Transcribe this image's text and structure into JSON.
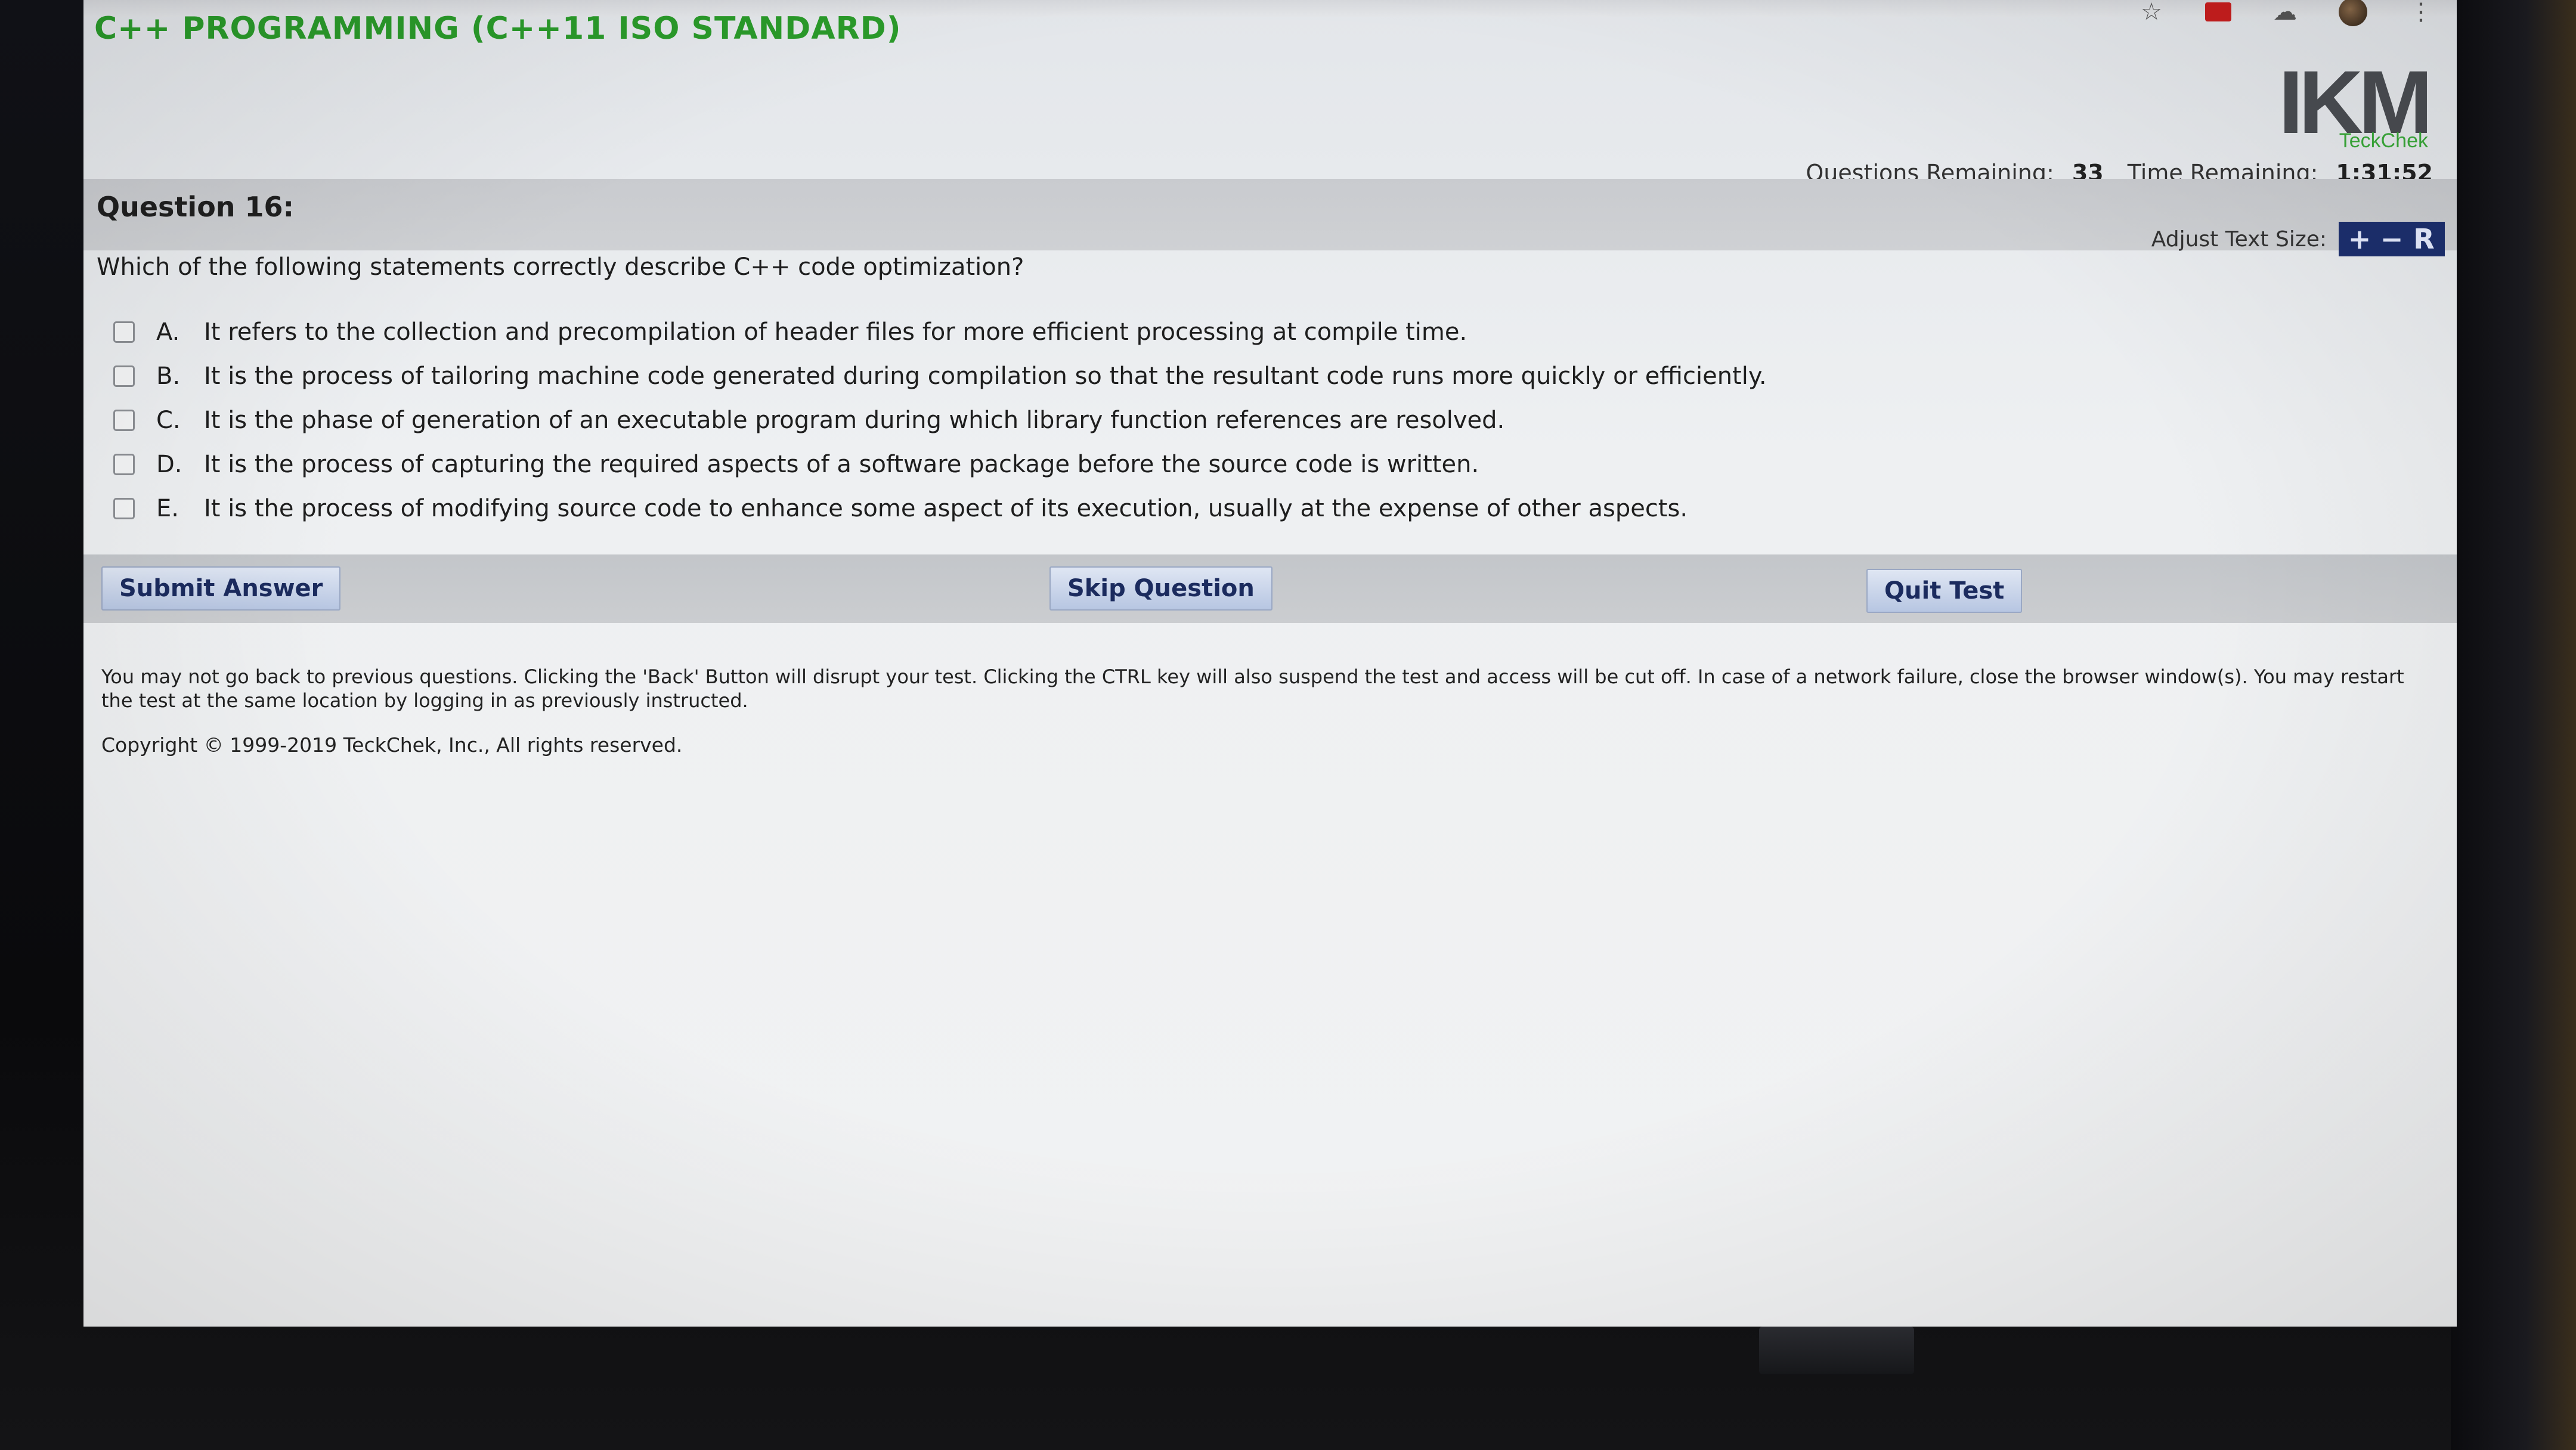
{
  "header": {
    "app_title": "C++ PROGRAMMING (C++11 ISO STANDARD)",
    "logo": {
      "text": "IKM",
      "subtext": "TeckChek"
    },
    "questions_remaining_label": "Questions Remaining:",
    "questions_remaining_value": "33",
    "time_remaining_label": "Time Remaining:",
    "time_remaining_value": "1:31:52"
  },
  "browser": {
    "icons": [
      "star-icon",
      "pdf-icon",
      "cloud-icon",
      "profile-avatar",
      "kebab-menu-icon"
    ]
  },
  "question": {
    "title": "Question 16:",
    "text": "Which of the following statements correctly describe C++ code optimization?",
    "adjust_text_label": "Adjust Text Size:",
    "adjust_buttons": [
      "+",
      "−",
      "R"
    ],
    "answers": [
      {
        "letter": "A.",
        "text": "It refers to the collection and precompilation of header files for more efficient processing at compile time."
      },
      {
        "letter": "B.",
        "text": "It is the process of tailoring machine code generated during compilation so that the resultant code runs more quickly or efficiently."
      },
      {
        "letter": "C.",
        "text": "It is the phase of generation of an executable program during which library function references are resolved."
      },
      {
        "letter": "D.",
        "text": "It is the process of capturing the required aspects of a software package before the source code is written."
      },
      {
        "letter": "E.",
        "text": "It is the process of modifying source code to enhance some aspect of its execution, usually at the expense of other aspects."
      }
    ]
  },
  "actions": {
    "submit": "Submit Answer",
    "skip": "Skip Question",
    "quit": "Quit Test"
  },
  "footer": {
    "notice": "You may not go back to previous questions. Clicking the 'Back' Button will disrupt your test. Clicking the CTRL key will also suspend the test and access will be cut off. In case of a network failure, close the browser window(s). You may restart the test at the same location by logging in as previously instructed.",
    "copyright": "Copyright © 1999-2019 TeckChek, Inc., All rights reserved."
  },
  "colors": {
    "title_green": "#2a9a2a",
    "button_text": "#1b2b5e",
    "adjust_bg": "#1c2f6e"
  }
}
